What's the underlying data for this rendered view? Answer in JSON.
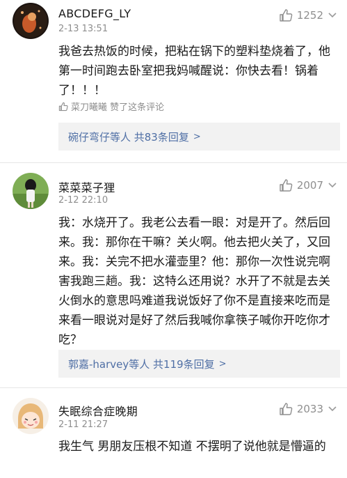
{
  "comments": [
    {
      "username": "ABCDEFG_LY",
      "time": "2-13 13:51",
      "likes": "1252",
      "text": "我爸去热饭的时候，把粘在锅下的塑料垫烧着了，他第一时间跑去卧室把我妈喊醒说：你快去看！锅着了！！！",
      "liked_by": "菜刀曦曦 赞了这条评论",
      "reply_summary": "碗仔弯仔等人 共83条回复"
    },
    {
      "username": "菜菜菜子狸",
      "time": "2-12 22:10",
      "likes": "2007",
      "text": "我：水烧开了。我老公去看一眼：对是开了。然后回来。我：那你在干嘛？关火啊。他去把火关了，又回来。我：关完不把水灌壶里？他：那你一次性说完啊害我跑三趟。我：这特么还用说？水开了不就是去关火倒水的意思吗难道我说饭好了你不是直接来吃而是来看一眼说对是好了然后我喊你拿筷子喊你开吃你才吃？",
      "reply_summary": "郭嘉-harvey等人 共119条回复"
    },
    {
      "username": "失眠综合症晚期",
      "time": "2-11 21:27",
      "likes": "2033",
      "text": "我生气 男朋友压根不知道 不摆明了说他就是懵逼的"
    }
  ],
  "icons": {
    "like": "thumbs-up-icon",
    "liked_by": "thumbs-up-small-icon",
    "chevron": "chevron-right-icon"
  },
  "colors": {
    "link": "#4f6fa5",
    "meta": "#8e8e8e",
    "reply_bg": "#f2f2f2"
  }
}
